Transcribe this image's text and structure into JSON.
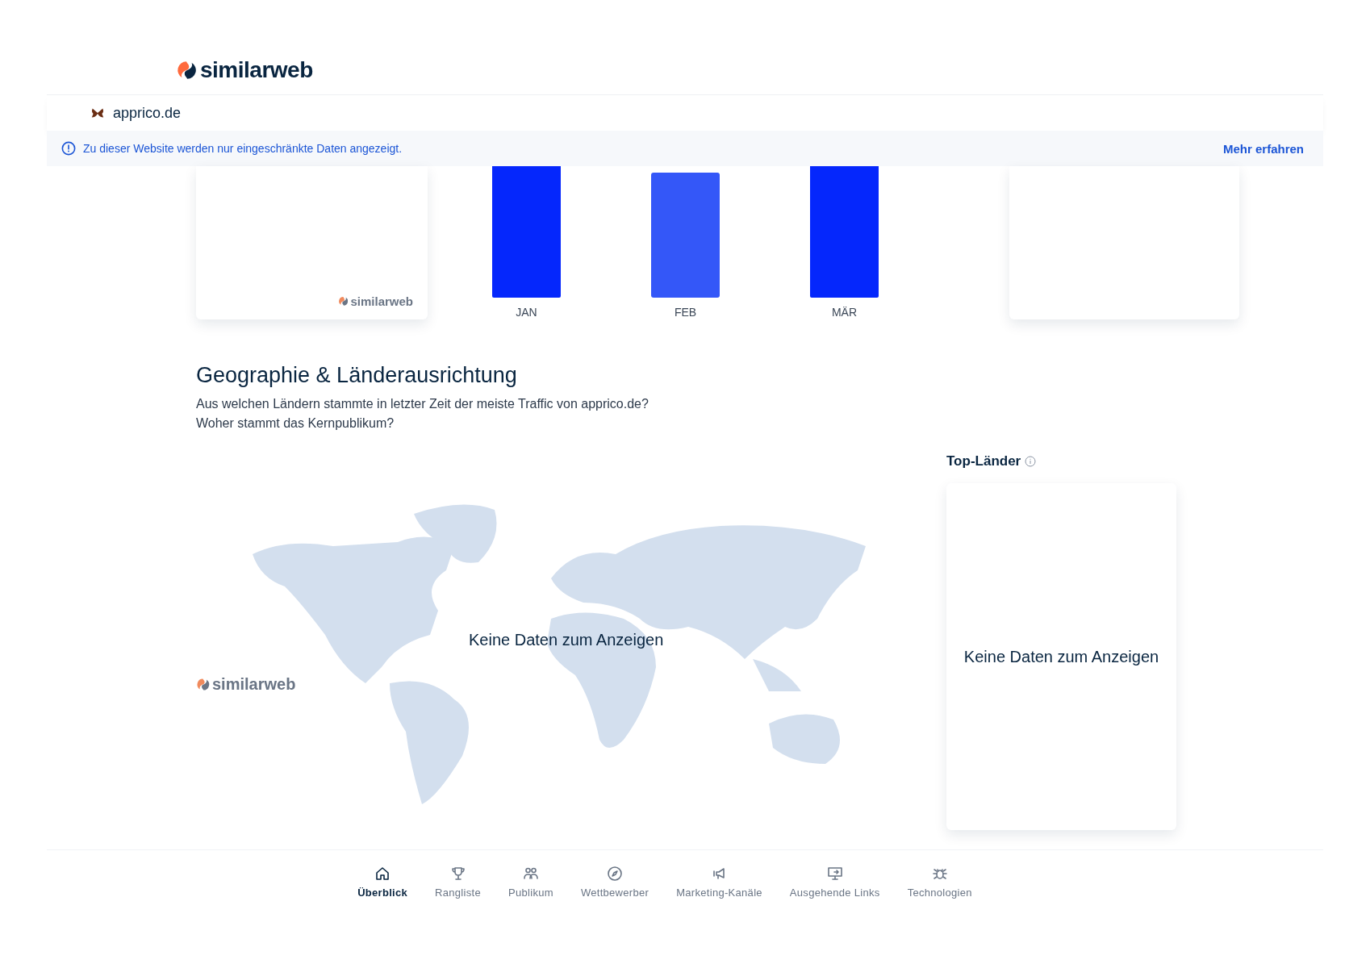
{
  "header": {
    "logo_text": "similarweb"
  },
  "site": {
    "domain": "apprico.de"
  },
  "notice": {
    "text": "Zu dieser Website werden nur eingeschränkte Daten angezeigt.",
    "link": "Mehr erfahren"
  },
  "traffic_cards": {
    "left_watermark": "similarweb",
    "bars": [
      {
        "label": "JAN",
        "color": "#0527fc"
      },
      {
        "label": "FEB",
        "color": "#3457f8"
      },
      {
        "label": "MÄR",
        "color": "#0527fc"
      }
    ]
  },
  "geography": {
    "title": "Geographie & Länderausrichtung",
    "subtitle_lines": [
      "Aus welchen Ländern stammte in letzter Zeit der meiste Traffic von apprico.de?",
      "Woher stammt das Kernpublikum?"
    ],
    "map_message": "Keine Daten zum Anzeigen",
    "map_watermark": "similarweb",
    "top_countries": {
      "title": "Top-Länder",
      "message": "Keine Daten zum Anzeigen"
    }
  },
  "bottom_nav": [
    {
      "kind": "home",
      "label": "Überblick",
      "selected": true
    },
    {
      "kind": "trophy",
      "label": "Rangliste",
      "selected": false
    },
    {
      "kind": "people",
      "label": "Publikum",
      "selected": false
    },
    {
      "kind": "compass",
      "label": "Wettbewerber",
      "selected": false
    },
    {
      "kind": "megaphone",
      "label": "Marketing-Kanäle",
      "selected": false
    },
    {
      "kind": "monitor",
      "label": "Ausgehende Links",
      "selected": false
    },
    {
      "kind": "bug",
      "label": "Technologien",
      "selected": false
    }
  ]
}
